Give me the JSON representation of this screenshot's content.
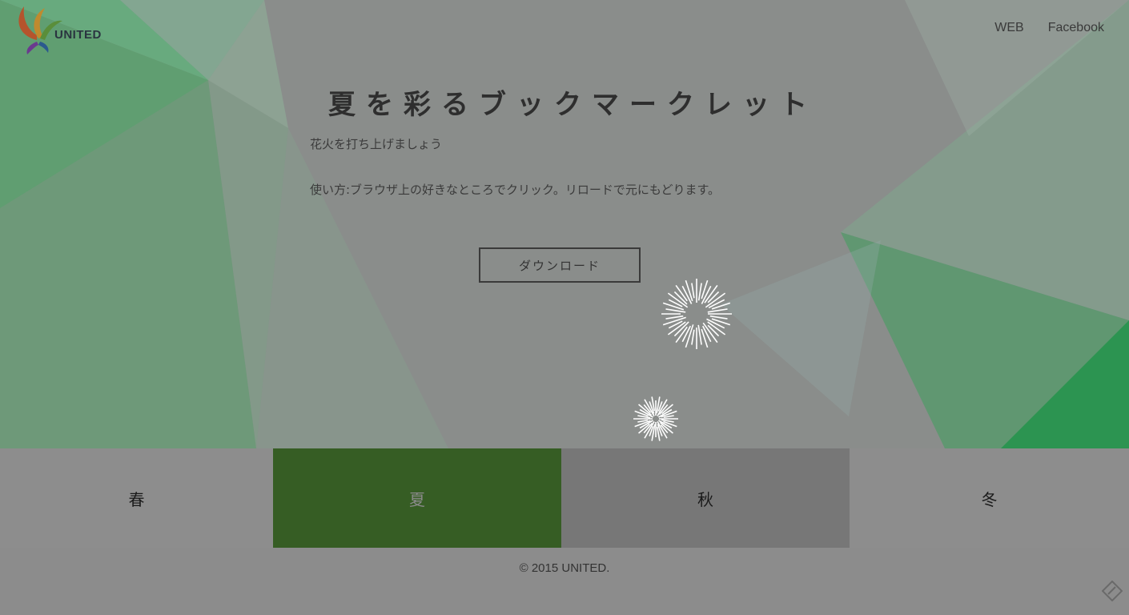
{
  "header": {
    "logo_text": "UNITED",
    "nav": [
      {
        "label": "WEB"
      },
      {
        "label": "Facebook"
      }
    ]
  },
  "main": {
    "title": "夏を彩るブックマークレット",
    "subtitle": "花火を打ち上げましょう",
    "usage": "使い方:ブラウザ上の好きなところでクリック。リロードで元にもどります。",
    "download_label": "ダウンロード"
  },
  "tabs": [
    {
      "label": "春",
      "bg": "#8d8d8d",
      "active": false
    },
    {
      "label": "夏",
      "bg": "#365d24",
      "active": true,
      "text_color": "#8a8a8a"
    },
    {
      "label": "秋",
      "bg": "#777777",
      "active": false
    },
    {
      "label": "冬",
      "bg": "#8d8d8d",
      "active": false
    }
  ],
  "footer": {
    "copyright": "© 2015 UNITED."
  },
  "colors": {
    "accent_green": "#2e9e4f",
    "active_tab": "#365d24",
    "overlay_gray": "#8a8d8b"
  },
  "icons": [
    "united-logo-icon",
    "firework-icon",
    "edit-corner-icon"
  ]
}
